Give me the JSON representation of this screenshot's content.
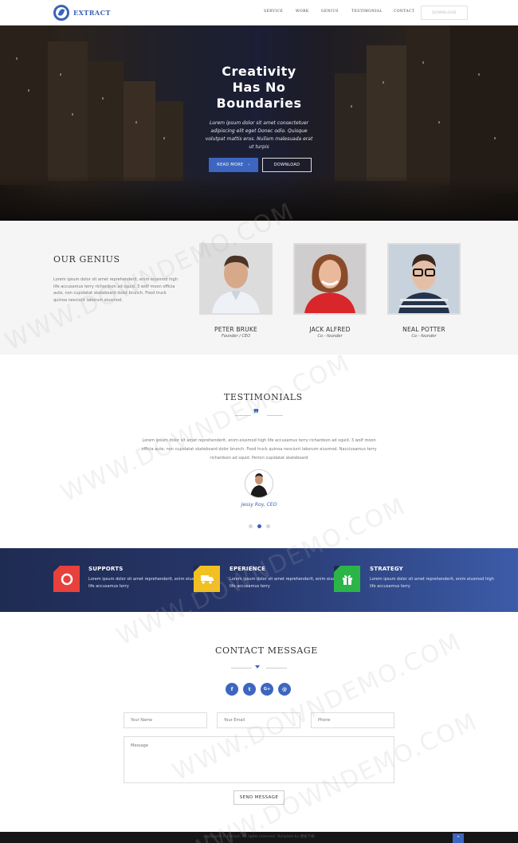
{
  "brand": {
    "name": "EXTRACT",
    "accent": "#3b63b6"
  },
  "nav": {
    "items": [
      "SERVICE",
      "WORK",
      "GENIUS",
      "TESTIMONIAL",
      "CONTACT"
    ],
    "download": "DOWNLOAD"
  },
  "hero": {
    "title_line1": "Creativity",
    "title_line2": "Has No",
    "title_line3": "Boundaries",
    "text": "Lorem ipsum dolor sit amet consectetuer adipiscing elit eget Donec odio. Quisque volutpat mattis eros. Nullam malesuada erat ut turpis",
    "read_more": "READ MORE",
    "download": "DOWNLOAD"
  },
  "genius": {
    "heading": "OUR GENIUS",
    "text": "Lorem ipsum dolor sit amet reprehenderit, enim eiusmod high life accusamus terry richardson ad squid. 3 wolf moon officia aute, non cupidatat skateboard dolor brunch. Food truck quinoa nesciunt laborum eiusmod.",
    "members": [
      {
        "name": "PETER BRUKE",
        "role": "Founder / CEO"
      },
      {
        "name": "JACK ALFRED",
        "role": "Co - founder"
      },
      {
        "name": "NEAL POTTER",
        "role": "Co - founder"
      }
    ]
  },
  "testimonials": {
    "heading": "TESTIMONIALS",
    "quote_icon": "quote-icon",
    "text": "Lorem ipsum dolor sit amet reprehenderit, enim eiusmod high life accusamus terry richardson ad squid. 3 wolf moon officia aute, non cupidatat skateboard dolor brunch. Food truck quinoa nesciunt laborum eiusmod. Nacciusamus terry richardson ad squid. Periori cupidatat skateboard",
    "author": "Jessy Roy, CEO",
    "active_slide": 2,
    "slides": 3
  },
  "features": [
    {
      "title": "SUPPORTS",
      "icon": "lifebuoy-icon",
      "color": "#e8413c",
      "text": "Lorem ipsum dolor sit amet reprehenderit, enim eiusmod high life accusamus terry"
    },
    {
      "title": "EPERIENCE",
      "icon": "truck-icon",
      "color": "#f3c021",
      "text": "Lorem ipsum dolor sit amet reprehenderit, enim eiusmod high life accusamus terry"
    },
    {
      "title": "STRATEGY",
      "icon": "gift-icon",
      "color": "#2bb548",
      "text": "Lorem ipsum dolor sit amet reprehenderit, enim eiusmod high life accusamus terry"
    }
  ],
  "contact": {
    "heading": "CONTACT  MESSAGE",
    "social": [
      {
        "icon": "facebook-icon",
        "glyph": "f"
      },
      {
        "icon": "twitter-icon",
        "glyph": "t"
      },
      {
        "icon": "google-plus-icon",
        "glyph": "G+"
      },
      {
        "icon": "email-icon",
        "glyph": "@"
      }
    ],
    "name_placeholder": "Your Name",
    "email_placeholder": "Your Email",
    "phone_placeholder": "Phone",
    "message_placeholder": "Message",
    "send": "SEND  MESSAGE"
  },
  "footer": {
    "text": "Copyright © Extract. All rights reserved. Template by 模板下载"
  },
  "watermark": "WWW.DOWNDEMO.COM"
}
